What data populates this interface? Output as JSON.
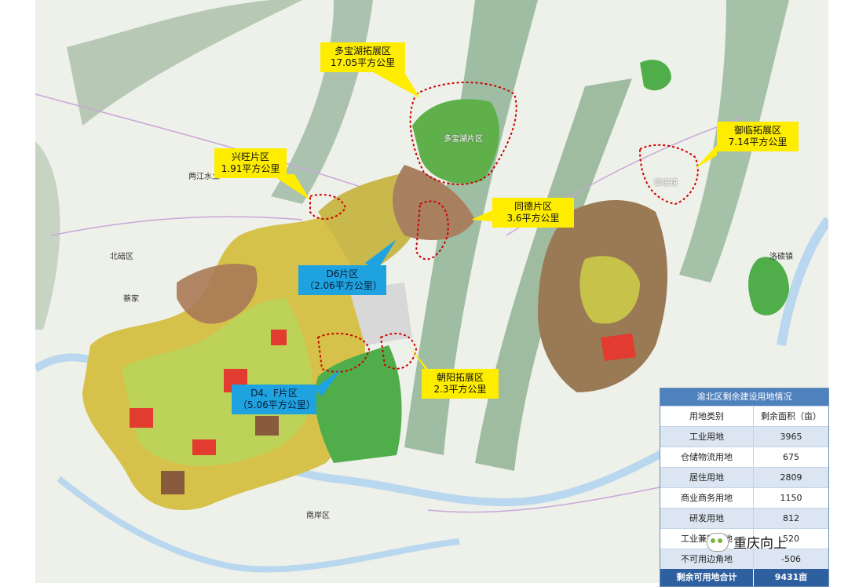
{
  "colors": {
    "callout_yellow": "#ffed00",
    "callout_blue": "#1fa3e0",
    "boundary_red": "#cc0000",
    "table_header": "#4f81bd",
    "table_footer": "#2e5f9e"
  },
  "callouts": {
    "duobaohu": {
      "name": "多宝湖拓展区",
      "area": "17.05平方公里"
    },
    "xingwang": {
      "name": "兴旺片区",
      "area": "1.91平方公里"
    },
    "tongde": {
      "name": "同德片区",
      "area": "3.6平方公里"
    },
    "yulin": {
      "name": "御临拓展区",
      "area": "7.14平方公里"
    },
    "d6": {
      "name": "D6片区",
      "area": "（2.06平方公里）"
    },
    "d4f": {
      "name": "D4、F片区",
      "area": "（5.06平方公里）"
    },
    "chaoyang": {
      "name": "朝阳拓展区",
      "area": "2.3平方公里"
    }
  },
  "places": {
    "beibei": "北碚区",
    "caijia": "蔡家",
    "nanan": "南岸区",
    "luoqi": "洛碛镇",
    "liangjiang": "两江水土",
    "duobaohu_label": "多宝湖片区",
    "yulin_label": "御临镇"
  },
  "table": {
    "title": "渝北区剩余建设用地情况",
    "headers": [
      "用地类别",
      "剩余面积（亩）"
    ],
    "rows": [
      [
        "工业用地",
        "3965"
      ],
      [
        "仓储物流用地",
        "675"
      ],
      [
        "居住用地",
        "2809"
      ],
      [
        "商业商务用地",
        "1150"
      ],
      [
        "研发用地",
        "812"
      ],
      [
        "工业兼容用地",
        "520"
      ],
      [
        "不可用边角地",
        "-506"
      ]
    ],
    "total_label": "剩余可用地合计",
    "total_value": "9431亩"
  },
  "watermark": {
    "text": "重庆向上",
    "icon": "wechat-icon"
  }
}
